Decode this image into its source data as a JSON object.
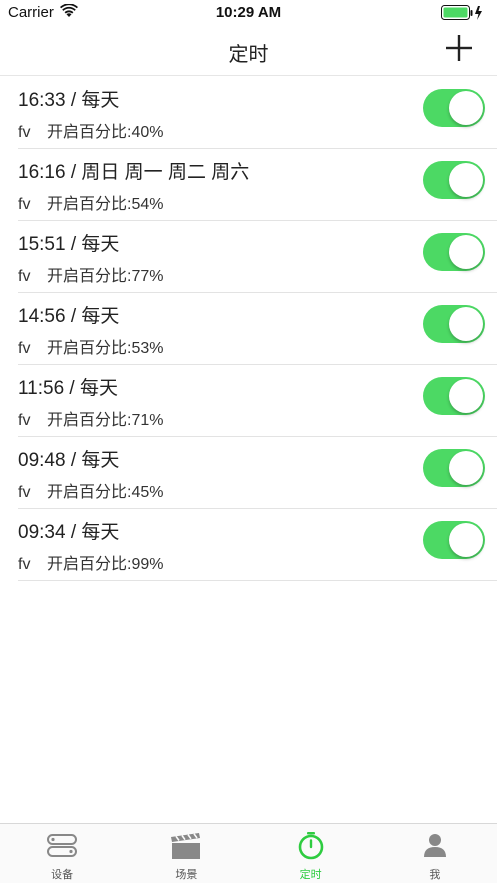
{
  "status_bar": {
    "carrier": "Carrier",
    "time": "10:29 AM"
  },
  "nav": {
    "title": "定时"
  },
  "colors": {
    "accent": "#2ecc40",
    "toggle_on": "#4cd964"
  },
  "timers": [
    {
      "title": "16:33 / 每天",
      "device": "fv",
      "detail": "开启百分比:40%",
      "enabled": true
    },
    {
      "title": "16:16 / 周日 周一 周二 周六",
      "device": "fv",
      "detail": "开启百分比:54%",
      "enabled": true
    },
    {
      "title": "15:51 / 每天",
      "device": "fv",
      "detail": "开启百分比:77%",
      "enabled": true
    },
    {
      "title": "14:56 / 每天",
      "device": "fv",
      "detail": "开启百分比:53%",
      "enabled": true
    },
    {
      "title": "11:56 / 每天",
      "device": "fv",
      "detail": "开启百分比:71%",
      "enabled": true
    },
    {
      "title": "09:48 / 每天",
      "device": "fv",
      "detail": "开启百分比:45%",
      "enabled": true
    },
    {
      "title": "09:34 / 每天",
      "device": "fv",
      "detail": "开启百分比:99%",
      "enabled": true
    }
  ],
  "tabs": [
    {
      "label": "设备",
      "icon": "device-icon",
      "active": false
    },
    {
      "label": "场景",
      "icon": "clapperboard-icon",
      "active": false
    },
    {
      "label": "定时",
      "icon": "stopwatch-icon",
      "active": true
    },
    {
      "label": "我",
      "icon": "person-icon",
      "active": false
    }
  ]
}
